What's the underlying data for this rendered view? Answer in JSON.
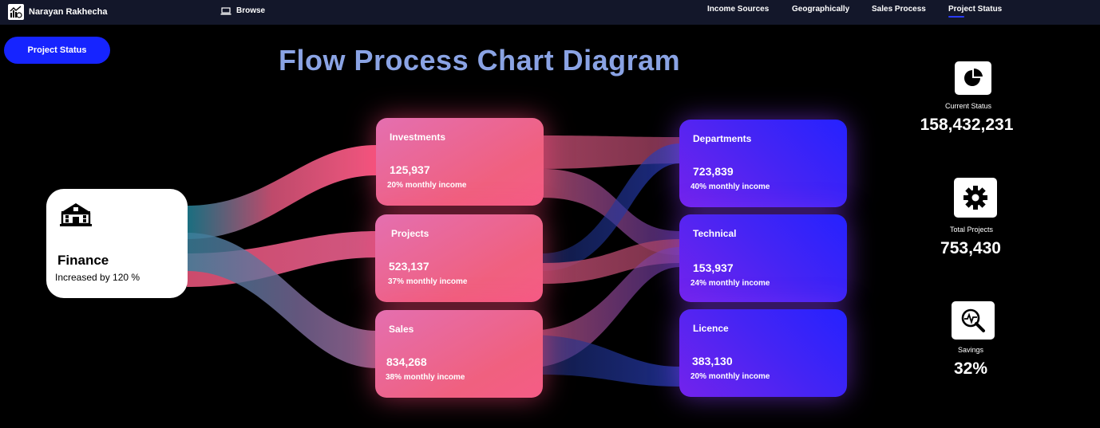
{
  "header": {
    "user_name": "Narayan Rakhecha",
    "browse_label": "Browse",
    "nav": [
      {
        "label": "Income Sources"
      },
      {
        "label": "Geographically"
      },
      {
        "label": "Sales Process"
      },
      {
        "label": "Project Status",
        "active": true
      }
    ]
  },
  "page": {
    "button_label": "Project Status",
    "title": "Flow Process Chart Diagram"
  },
  "source": {
    "title": "Finance",
    "subtitle": "Increased by 120 %",
    "icon": "bank-building-icon"
  },
  "middle": [
    {
      "name": "Investments",
      "value": "125,937",
      "sub": "20% monthly income"
    },
    {
      "name": "Projects",
      "value": "523,137",
      "sub": "37% monthly income"
    },
    {
      "name": "Sales",
      "value": "834,268",
      "sub": "38% monthly income"
    }
  ],
  "targets": [
    {
      "name": "Departments",
      "value": "723,839",
      "sub": "40% monthly income"
    },
    {
      "name": "Technical",
      "value": "153,937",
      "sub": "24% monthly income"
    },
    {
      "name": "Licence",
      "value": "383,130",
      "sub": "20% monthly income"
    }
  ],
  "stats": [
    {
      "label": "Current Status",
      "value": "158,432,231",
      "icon": "pie-chart-icon"
    },
    {
      "label": "Total Projects",
      "value": "753,430",
      "icon": "gear-icon"
    },
    {
      "label": "Savings",
      "value": "32%",
      "icon": "magnifier-pulse-icon"
    }
  ],
  "colors": {
    "topbar": "#13172a",
    "accent": "#1624ff",
    "title": "#8aa3e4",
    "pink": "#f0607f",
    "blue": "#2522ff",
    "teal": "#2e8ea6"
  }
}
